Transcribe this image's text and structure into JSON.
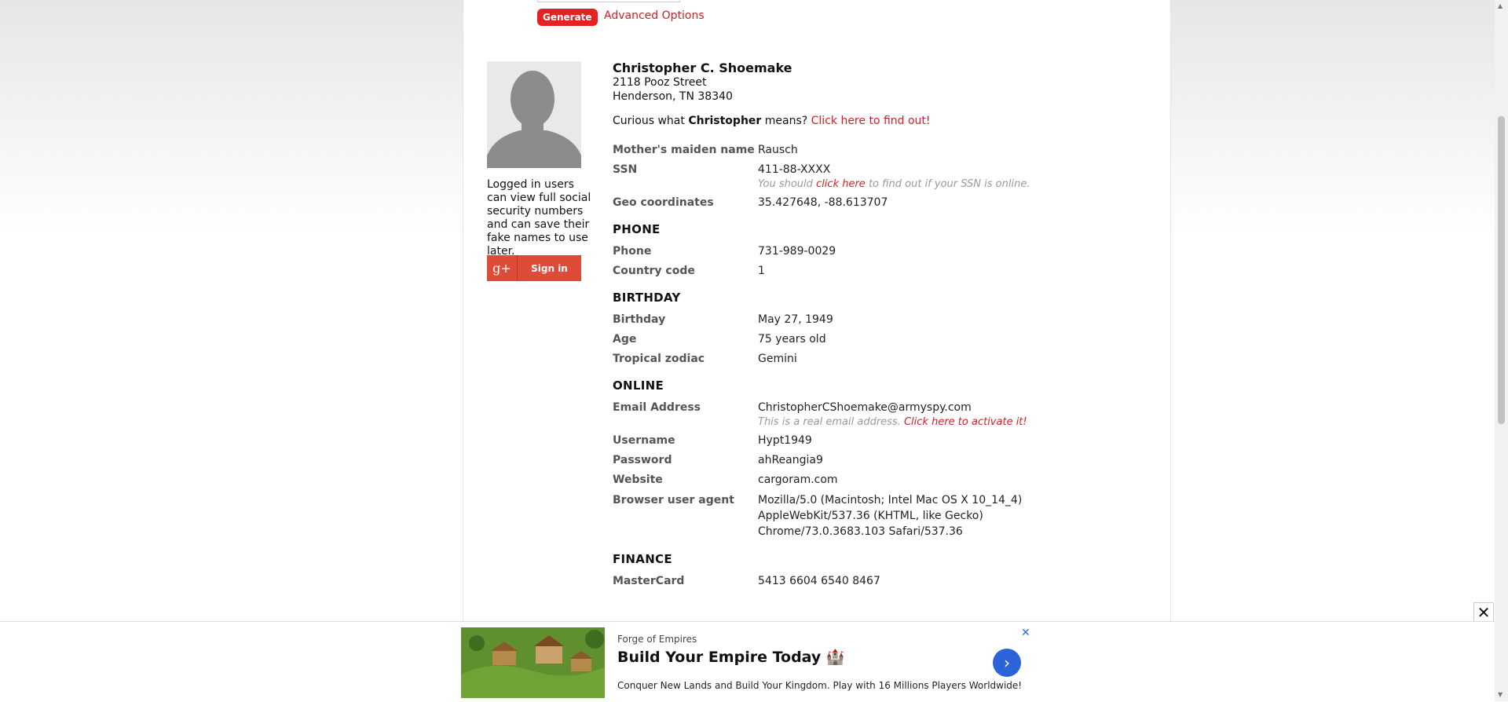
{
  "form": {
    "generate_label": "Generate",
    "advanced_label": "Advanced Options"
  },
  "sidebar": {
    "note": "Logged in users can view full social security numbers and can save their fake names to use later.",
    "signin_label": "Sign in",
    "signin_icon_text": "g+"
  },
  "identity": {
    "name": "Christopher C. Shoemake",
    "street": "2118 Pooz Street",
    "city_line": "Henderson, TN 38340",
    "curious_prefix": "Curious what ",
    "first_name": "Christopher",
    "curious_suffix": " means? ",
    "curious_link": "Click here to find out!"
  },
  "details": {
    "maiden_label": "Mother's maiden name",
    "maiden": "Rausch",
    "ssn_label": "SSN",
    "ssn": "411-88-XXXX",
    "ssn_note_prefix": "You should ",
    "ssn_note_link": "click here",
    "ssn_note_suffix": " to find out if your SSN is online.",
    "geo_label": "Geo coordinates",
    "geo": "35.427648, -88.613707"
  },
  "phone": {
    "heading": "PHONE",
    "phone_label": "Phone",
    "phone": "731-989-0029",
    "cc_label": "Country code",
    "cc": "1"
  },
  "birthday": {
    "heading": "BIRTHDAY",
    "bday_label": "Birthday",
    "bday": "May 27, 1949",
    "age_label": "Age",
    "age": "75 years old",
    "zodiac_label": "Tropical zodiac",
    "zodiac": "Gemini"
  },
  "online": {
    "heading": "ONLINE",
    "email_label": "Email Address",
    "email": "ChristopherCShoemake@armyspy.com",
    "email_note_prefix": "This is a real email address. ",
    "email_note_link": "Click here to activate it!",
    "username_label": "Username",
    "username": "Hypt1949",
    "password_label": "Password",
    "password": "ahReangia9",
    "website_label": "Website",
    "website": "cargoram.com",
    "ua_label": "Browser user agent",
    "ua_line1": "Mozilla/5.0 (Macintosh; Intel Mac OS X 10_14_4)",
    "ua_line2": "AppleWebKit/537.36 (KHTML, like Gecko)",
    "ua_line3": "Chrome/73.0.3683.103 Safari/537.36"
  },
  "finance": {
    "heading": "FINANCE",
    "mc_label": "MasterCard",
    "mc": "5413 6604 6540 8467"
  },
  "ad": {
    "brand": "Forge of Empires",
    "title": "Build Your Empire Today 🏰",
    "desc": "Conquer New Lands and Build Your Kingdom. Play with 16 Millions Players Worldwide!"
  }
}
